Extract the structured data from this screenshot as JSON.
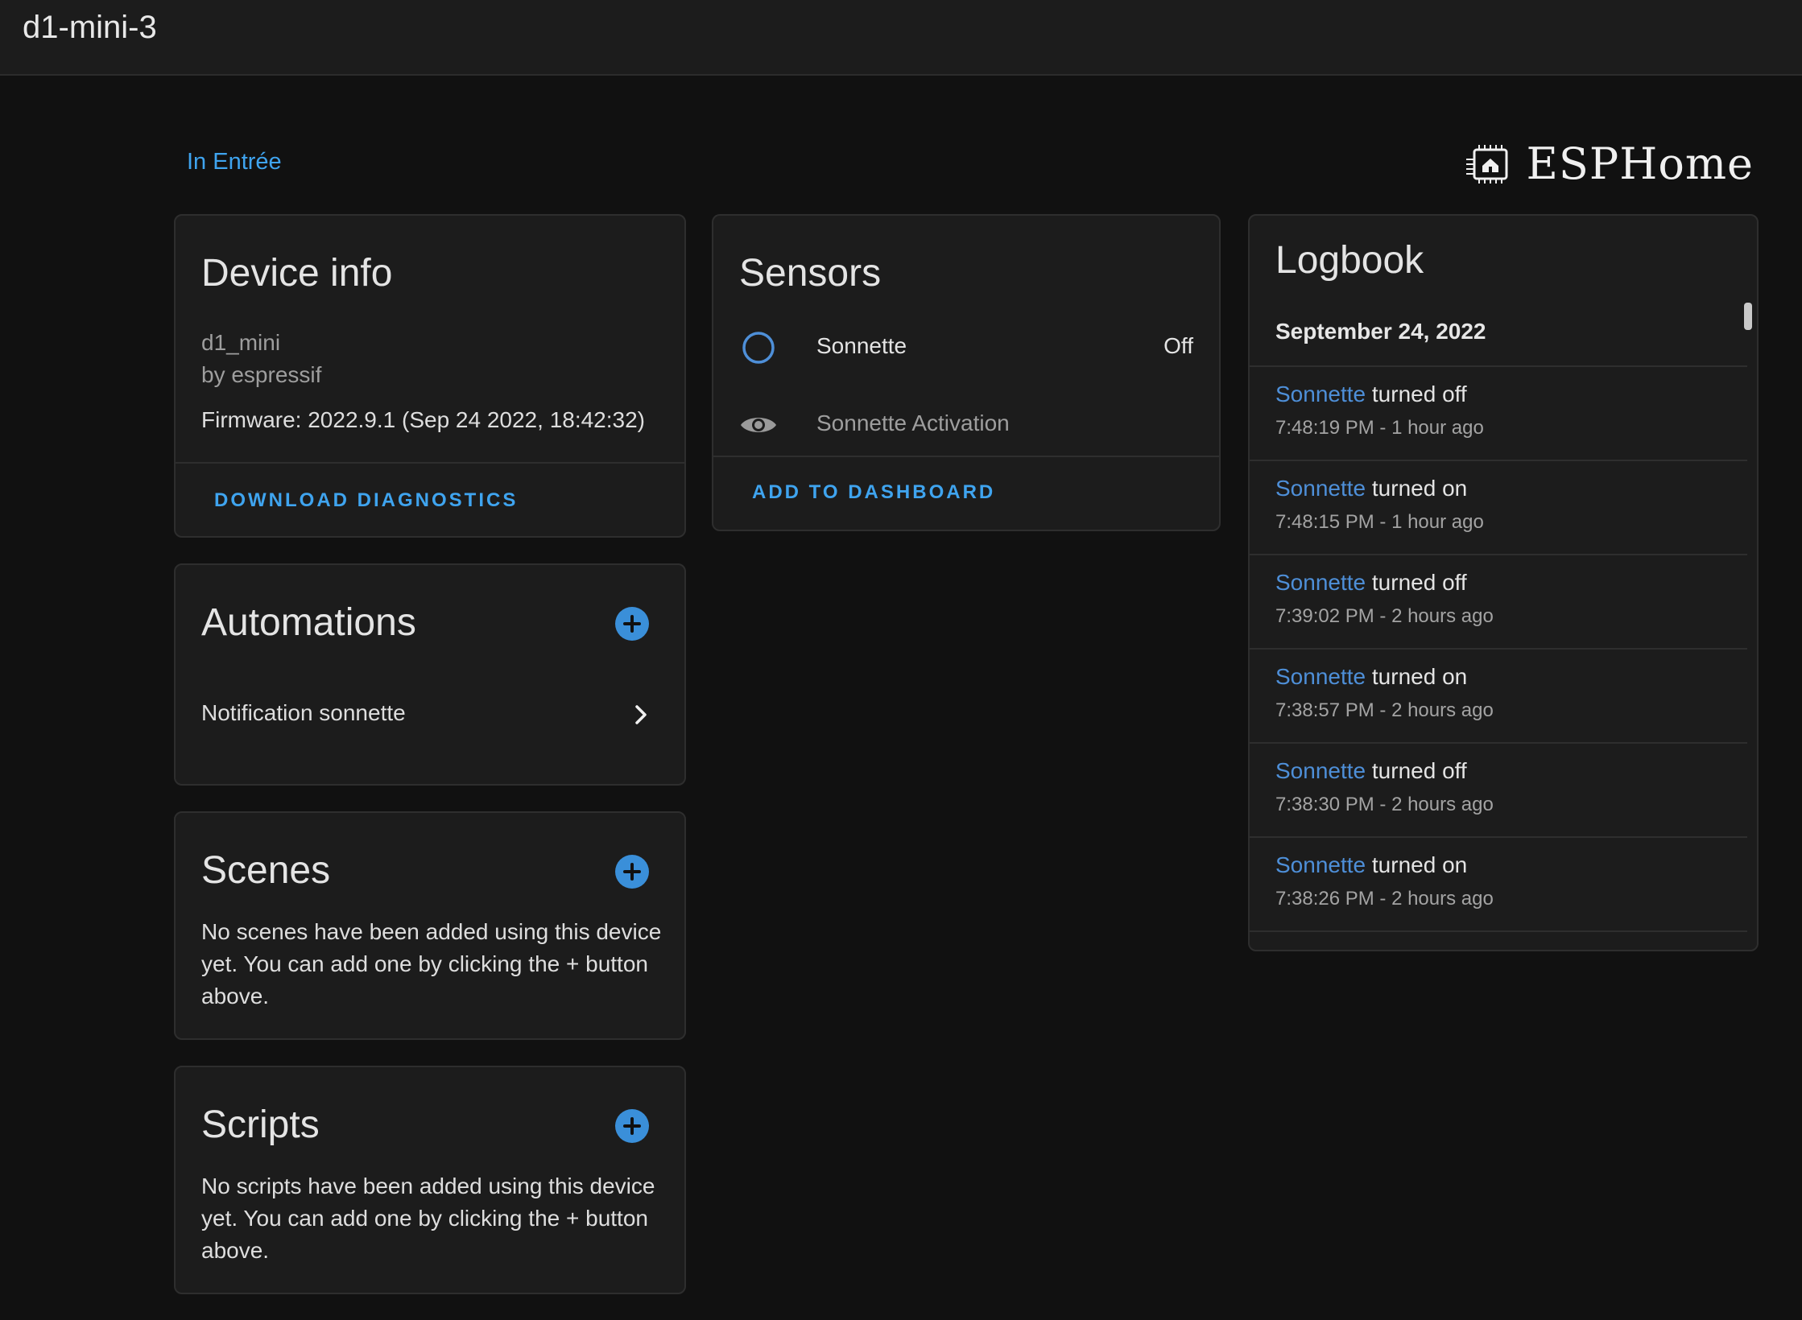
{
  "header": {
    "title": "d1-mini-3"
  },
  "area": {
    "link": "In Entrée"
  },
  "brand": {
    "name": "ESPHome",
    "icon": "esphome-chip-icon"
  },
  "device_info": {
    "title": "Device info",
    "model": "d1_mini",
    "manufacturer": "by espressif",
    "firmware": "Firmware: 2022.9.1 (Sep 24 2022, 18:42:32)",
    "action": "DOWNLOAD DIAGNOSTICS"
  },
  "automations": {
    "title": "Automations",
    "items": [
      {
        "label": "Notification sonnette"
      }
    ]
  },
  "scenes": {
    "title": "Scenes",
    "empty_text": "No scenes have been added using this device yet. You can add one by clicking the + button above."
  },
  "scripts": {
    "title": "Scripts",
    "empty_text": "No scripts have been added using this device yet. You can add one by clicking the + button above."
  },
  "sensors": {
    "title": "Sensors",
    "items": [
      {
        "name": "Sonnette",
        "state": "Off",
        "icon": "circle-outline-icon"
      },
      {
        "name": "Sonnette Activation",
        "state": "",
        "icon": "eye-icon"
      }
    ],
    "action": "ADD TO DASHBOARD"
  },
  "logbook": {
    "title": "Logbook",
    "date": "September 24, 2022",
    "entries": [
      {
        "entity": "Sonnette",
        "message": "turned off",
        "time": "7:48:19 PM - 1 hour ago"
      },
      {
        "entity": "Sonnette",
        "message": "turned on",
        "time": "7:48:15 PM - 1 hour ago"
      },
      {
        "entity": "Sonnette",
        "message": "turned off",
        "time": "7:39:02 PM - 2 hours ago"
      },
      {
        "entity": "Sonnette",
        "message": "turned on",
        "time": "7:38:57 PM - 2 hours ago"
      },
      {
        "entity": "Sonnette",
        "message": "turned off",
        "time": "7:38:30 PM - 2 hours ago"
      },
      {
        "entity": "Sonnette",
        "message": "turned on",
        "time": "7:38:26 PM - 2 hours ago"
      }
    ]
  },
  "colors": {
    "accent": "#3fa4ef",
    "entity_link": "#4e8fd8",
    "background": "#111111",
    "card": "#1c1c1c"
  }
}
